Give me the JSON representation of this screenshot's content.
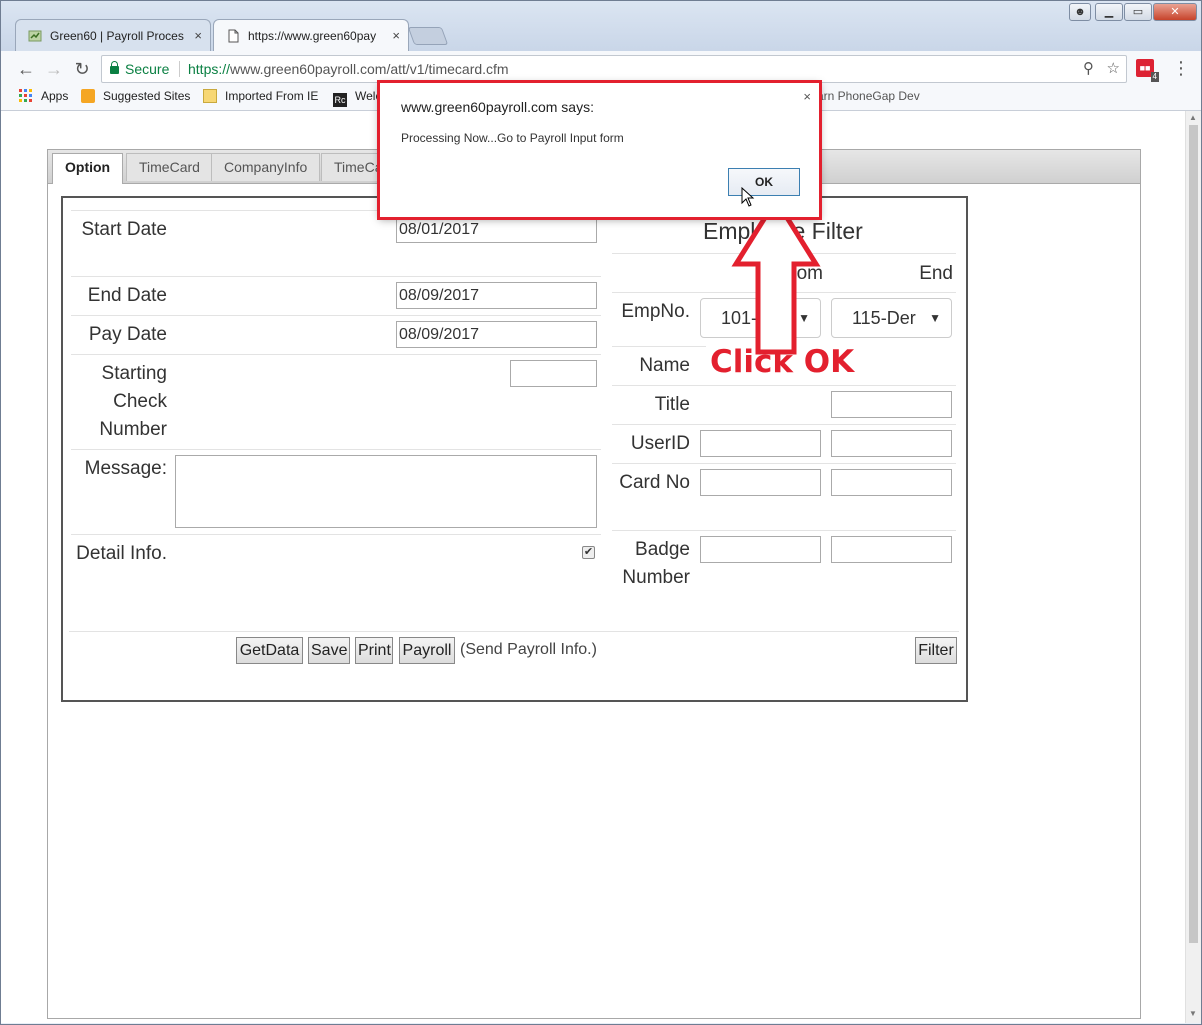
{
  "browser": {
    "tabs": [
      {
        "title": "Green60 | Payroll Proces",
        "close": "×"
      },
      {
        "title": "https://www.green60pay",
        "close": "×"
      }
    ],
    "window_controls": [
      "▁",
      "▭",
      "✕"
    ],
    "secure_label": "Secure",
    "url_scheme": "https://",
    "url_host": "www.green60payroll.com",
    "url_path": "/att/v1/timecard.cfm",
    "extension_count": "4",
    "bookmarks": [
      {
        "label": "Apps"
      },
      {
        "label": "Suggested Sites"
      },
      {
        "label": "Imported From IE"
      },
      {
        "label": "Welc"
      },
      {
        "label": "arn PhoneGap Dev"
      }
    ]
  },
  "page": {
    "tabs": [
      "Option",
      "TimeCard",
      "CompanyInfo",
      "TimeCa"
    ],
    "form": {
      "start_date_label": "Start Date",
      "start_date": "08/01/2017",
      "end_date_label": "End Date",
      "end_date": "08/09/2017",
      "pay_date_label": "Pay Date",
      "pay_date": "08/09/2017",
      "starting_check_label": "Starting Check Number",
      "starting_check": "",
      "message_label": "Message:",
      "detail_label": "Detail Info.",
      "detail_checked": "✔"
    },
    "filter": {
      "title": "Employee Filter",
      "from_label": "From",
      "end_label": "End",
      "empno_label": "EmpNo.",
      "empno_from": "101-Jim",
      "empno_end": "115-Der",
      "name_label": "Name",
      "title_label": "Title",
      "userid_label": "UserID",
      "cardno_label": "Card No",
      "badge_label": "Badge Number"
    },
    "buttons": {
      "getdata": "GetData",
      "save": "Save",
      "print": "Print",
      "payroll": "Payroll",
      "payroll_note": "(Send Payroll Info.)",
      "filter": "Filter"
    }
  },
  "dialog": {
    "title": "www.green60payroll.com says:",
    "message": "Processing Now...Go to Payroll Input form",
    "ok": "OK",
    "close": "×"
  },
  "annotation": {
    "text": "Click OK",
    "color": "#e3202e"
  }
}
